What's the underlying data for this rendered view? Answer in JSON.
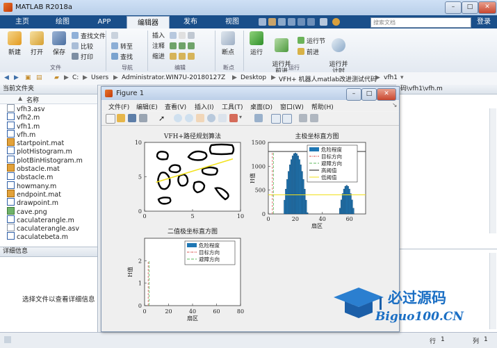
{
  "app": {
    "title": "MATLAB R2018a",
    "tabs": [
      "主页",
      "绘图",
      "APP",
      "编辑器",
      "发布",
      "视图"
    ],
    "active_tab": "编辑器",
    "search_placeholder": "搜索文档",
    "login": "登录"
  },
  "ribbon": {
    "new": "新建",
    "open": "打开",
    "save": "保存",
    "find_files": "查找文件",
    "compare": "比较",
    "print": "打印",
    "goto": "转至",
    "find": "查找",
    "insert": "插入",
    "comment": "注释",
    "indent": "缩进",
    "breakpoints": "断点",
    "run": "运行",
    "run_advance": "运行并\n前进",
    "run_section": "运行节",
    "advance": "前进",
    "run_time": "运行并\n计时",
    "groups": [
      "文件",
      "导航",
      "编辑",
      "断点",
      "运行"
    ]
  },
  "address": {
    "crumbs": [
      "C:",
      "Users",
      "Administrator.WIN7U-20180127Z",
      "Desktop",
      "VFH+ 机器人matlab改进测试代码",
      "vfh1"
    ],
    "right_path": "码\\vfh1\\vfh.m"
  },
  "left_panel": {
    "header": "当前文件夹",
    "column": "名称",
    "sort_arrow": "▲",
    "files": [
      {
        "name": "vfh3.asv",
        "kind": "asv"
      },
      {
        "name": "vfh2.m",
        "kind": "m"
      },
      {
        "name": "vfh1.m",
        "kind": "m"
      },
      {
        "name": "vfh.m",
        "kind": "m"
      },
      {
        "name": "startpoint.mat",
        "kind": "mat"
      },
      {
        "name": "plotHistogram.m",
        "kind": "m"
      },
      {
        "name": "plotBinHistogram.m",
        "kind": "m"
      },
      {
        "name": "obstacle.mat",
        "kind": "mat"
      },
      {
        "name": "obstacle.m",
        "kind": "m"
      },
      {
        "name": "howmany.m",
        "kind": "m"
      },
      {
        "name": "endpoint.mat",
        "kind": "mat"
      },
      {
        "name": "drawpoint.m",
        "kind": "m"
      },
      {
        "name": "cave.png",
        "kind": "png"
      },
      {
        "name": "caculaterangle.m",
        "kind": "m"
      },
      {
        "name": "caculaterangle.asv",
        "kind": "asv"
      },
      {
        "name": "caculatebeta.m",
        "kind": "m"
      }
    ],
    "details_header": "详细信息",
    "details_text": "选择文件以查看详细信息"
  },
  "status": {
    "row_label": "行",
    "row_value": "1",
    "col_label": "列",
    "col_value": "1"
  },
  "figure": {
    "title": "Figure 1",
    "menu": [
      "文件(F)",
      "编辑(E)",
      "查看(V)",
      "插入(I)",
      "工具(T)",
      "桌面(D)",
      "窗口(W)",
      "帮助(H)"
    ],
    "colors": {
      "bar": "#1f77b4",
      "target": "#d9534f",
      "avoid": "#5cb85c",
      "high": "#111111",
      "low": "#f1e01b"
    }
  },
  "chart_data": [
    {
      "type": "line",
      "title": "VFH+路径规划算法",
      "xlim": [
        0,
        10
      ],
      "ylim": [
        0,
        10
      ],
      "xticks": [
        "0",
        "5",
        "10"
      ],
      "yticks": [
        "0",
        "5",
        "10"
      ],
      "series": [
        {
          "values": [
            [
              1.2,
              4.2
            ],
            [
              9.2,
              7.6
            ]
          ]
        }
      ],
      "obstacles": "black closed loops"
    },
    {
      "type": "bar",
      "title": "主极坐标直方图",
      "ylabel": "H值",
      "xlabel": "扇区",
      "xlim": [
        0,
        72
      ],
      "ylim": [
        0,
        1500
      ],
      "xticks": [
        "0",
        "20",
        "40",
        "60"
      ],
      "yticks": [
        "0",
        "500",
        "1000",
        "1500"
      ],
      "legend": [
        "危险程度",
        "目标方向",
        "避障方向",
        "高阈值",
        "低阈值"
      ],
      "legend_position": "top-right",
      "bar_groups": [
        {
          "x_from": 12,
          "x_to": 29,
          "peak": 1280,
          "center": 20
        },
        {
          "x_from": 53,
          "x_to": 63,
          "peak": 600,
          "center": 58
        }
      ],
      "target_direction_x": 3,
      "avoid_direction_x": 3,
      "high_threshold": 1310,
      "low_threshold": 400
    },
    {
      "type": "bar",
      "title": "二值极坐标直方图",
      "ylabel": "H值",
      "xlabel": "扇区",
      "xlim": [
        0,
        80
      ],
      "ylim": [
        0,
        3
      ],
      "xticks": [
        "0",
        "20",
        "40",
        "60",
        "80"
      ],
      "yticks": [
        "0",
        "1",
        "2"
      ],
      "legend": [
        "危险程度",
        "目标方向",
        "避障方向"
      ],
      "legend_position": "top-right",
      "target_direction_x": 3,
      "avoid_direction_x": 3,
      "line_top": 2
    }
  ],
  "watermark": {
    "line1": "必过源码",
    "line2": "Biguo100.CN"
  }
}
